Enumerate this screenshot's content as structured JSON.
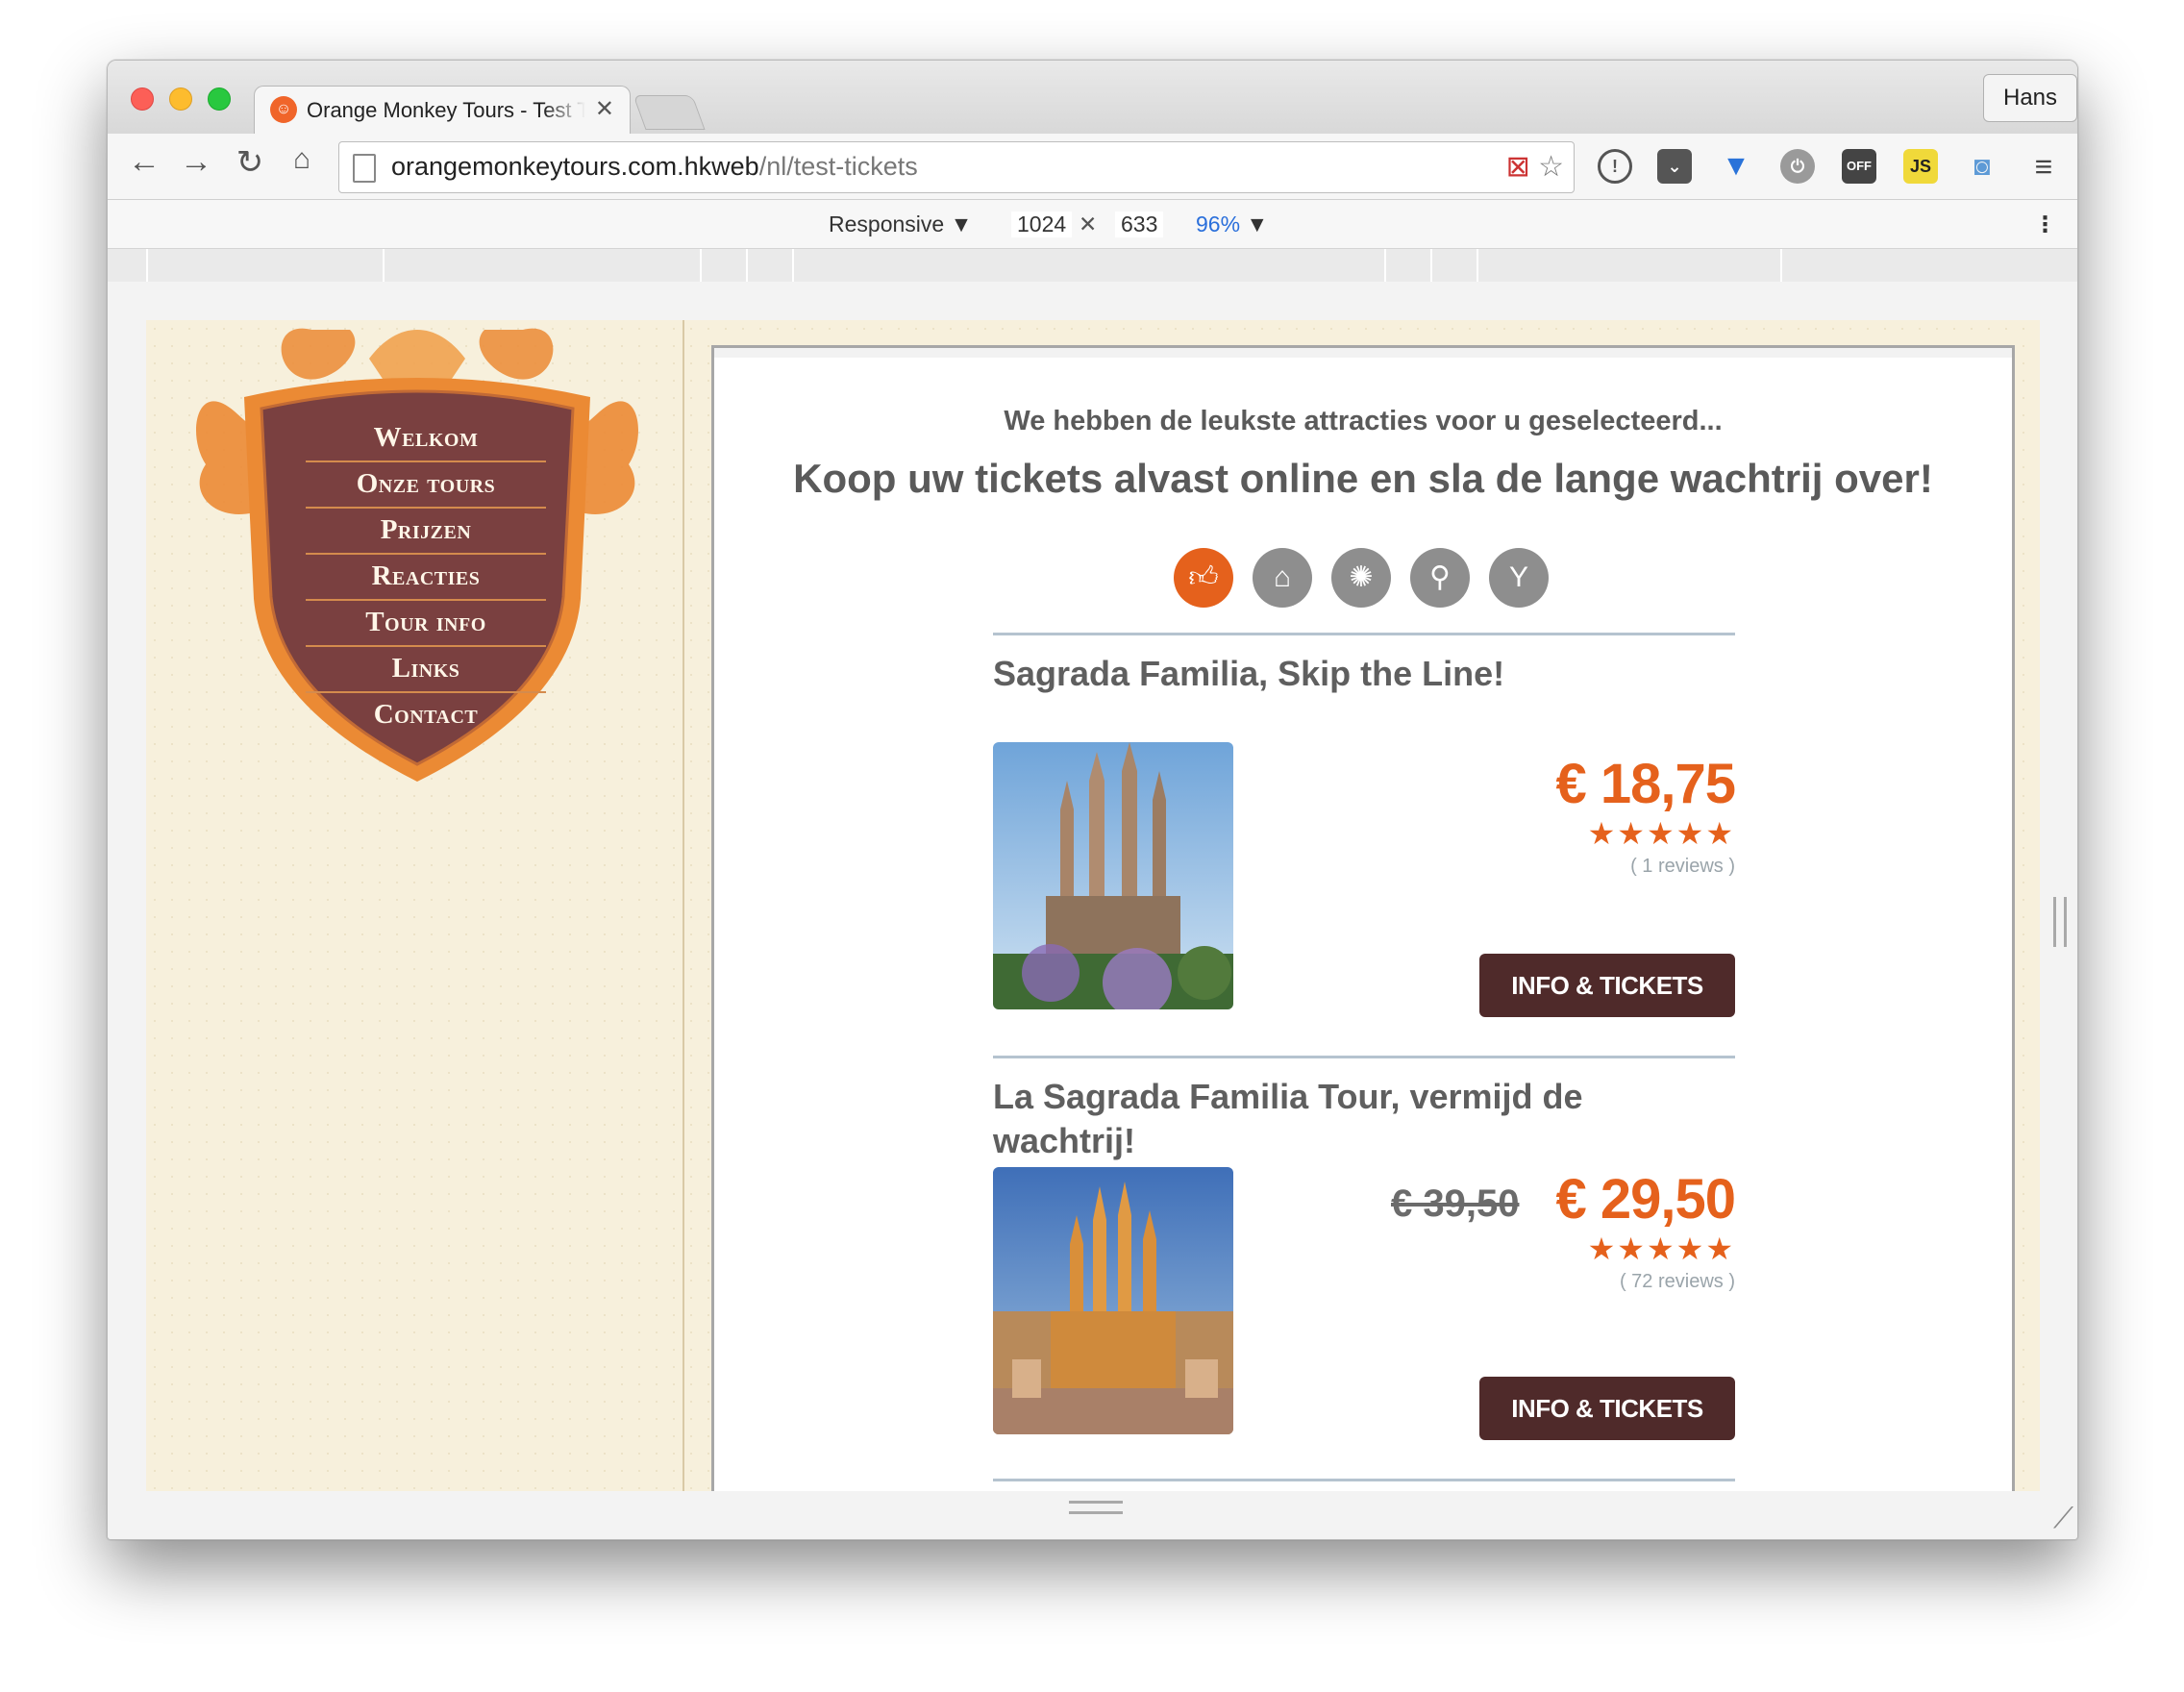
{
  "browser": {
    "tab_title": "Orange Monkey Tours - Test Tickets",
    "profile": "Hans",
    "url_host": "orangemonkeytours.com.hkweb",
    "url_path": "/nl/test-tickets"
  },
  "devtools": {
    "mode": "Responsive",
    "width": "1024",
    "height": "633",
    "zoom": "96%"
  },
  "nav": {
    "items": [
      "Welkom",
      "Onze tours",
      "Prijzen",
      "Reacties",
      "Tour info",
      "Links",
      "Contact"
    ]
  },
  "intro": {
    "subtitle": "We hebben de leukste attracties voor u geselecteerd...",
    "headline": "Koop uw tickets alvast online en sla de lange wachtrij over!"
  },
  "categories": [
    "thumbs-up-icon",
    "museum-icon",
    "ferris-wheel-icon",
    "walking-icon",
    "cocktail-icon"
  ],
  "listings": [
    {
      "title": "Sagrada Familia, Skip the Line!",
      "price": "€ 18,75",
      "old_price": "",
      "stars": "★★★★★",
      "reviews": "( 1 reviews )",
      "button": "INFO & TICKETS"
    },
    {
      "title": "La Sagrada Familia Tour, vermijd de wachtrij!",
      "price": "€ 29,50",
      "old_price": "€ 39,50",
      "stars": "★★★★★",
      "reviews": "( 72 reviews )",
      "button": "INFO & TICKETS"
    }
  ],
  "colors": {
    "accent": "#e5611c",
    "button": "#4f2a2a",
    "crest": "#7a4040"
  }
}
